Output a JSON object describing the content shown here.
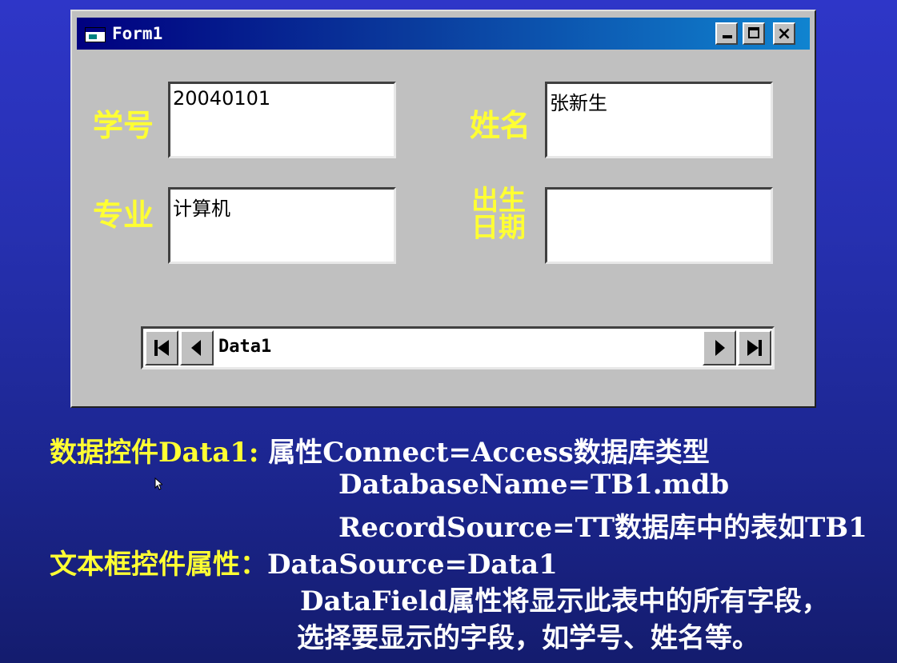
{
  "window": {
    "title": "Form1",
    "buttons": {
      "minimize": "minimize-button",
      "maximize": "maximize-button",
      "close": "×"
    }
  },
  "form": {
    "fields": [
      {
        "label": "学号",
        "value": "20040101"
      },
      {
        "label": "姓名",
        "value": "张新生"
      },
      {
        "label": "专业",
        "value": "计算机"
      },
      {
        "label_line1": "出生",
        "label_line2": "日期",
        "value": ""
      }
    ],
    "data_control": {
      "caption": "Data1"
    }
  },
  "notes": {
    "line1_prefix": "数据控件Data1:",
    "line1_rest": "属性Connect=Access数据库类型",
    "line2": "DatabaseName=TB1.mdb",
    "line3": "RecordSource=TT数据库中的表如TB1",
    "line4_prefix": "文本框控件属性：",
    "line4_rest": "DataSource=Data1",
    "line5": "DataField属性将显示此表中的所有字段，",
    "line6": "选择要显示的字段，如学号、姓名等。"
  },
  "colors": {
    "background": "#2630b0",
    "label_yellow": "#ffff33",
    "title_bar": "#000080",
    "form_face": "#c0c0c0"
  }
}
